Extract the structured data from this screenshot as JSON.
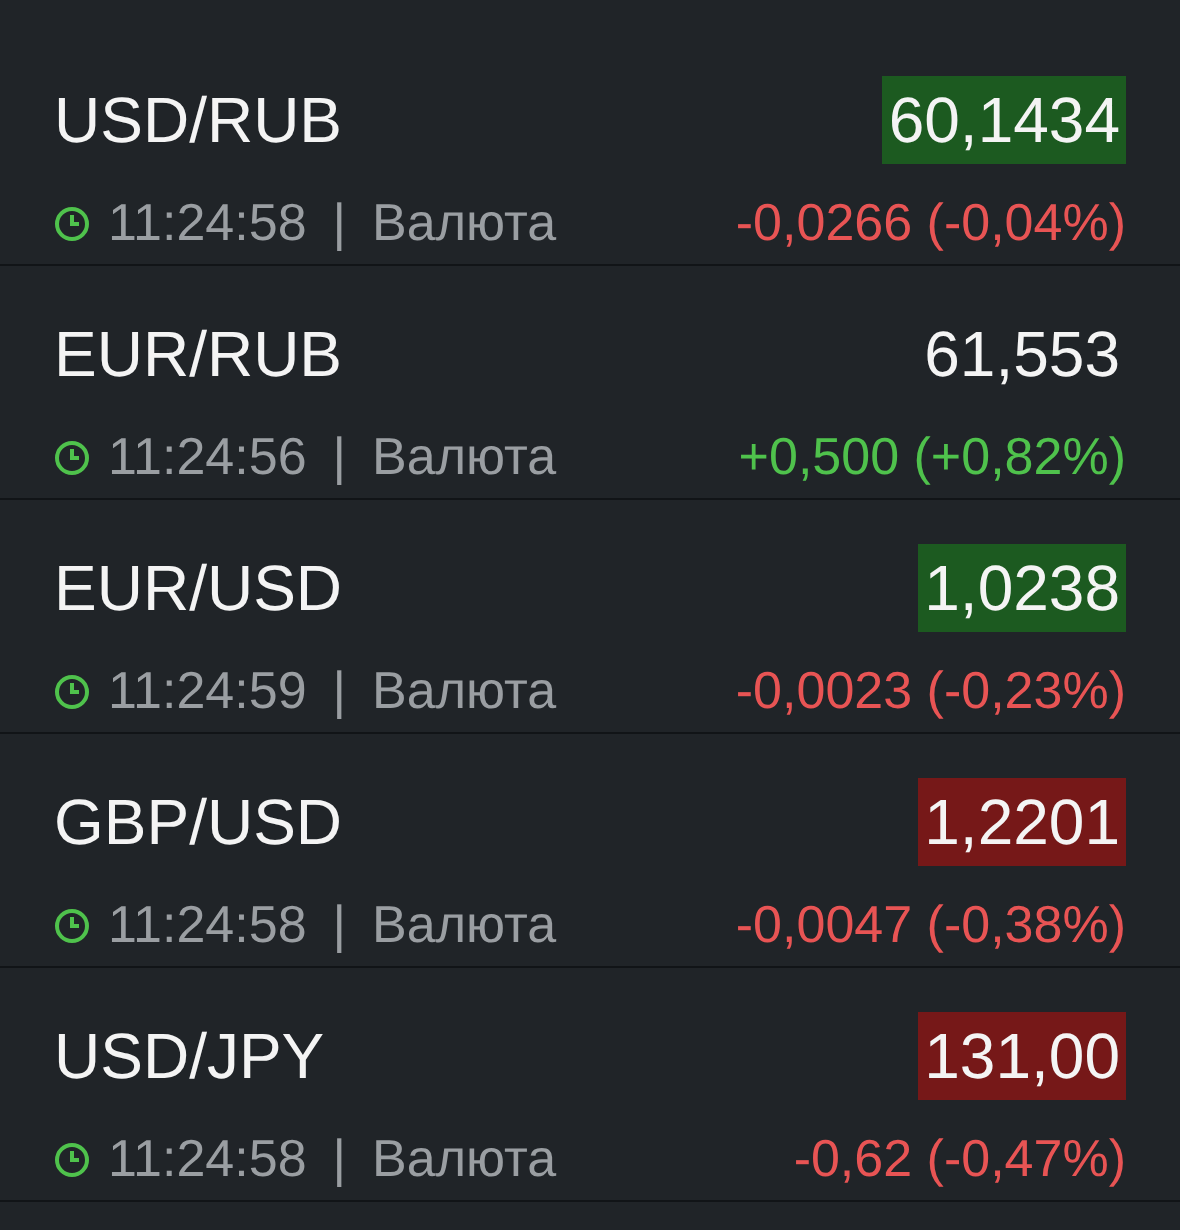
{
  "quotes": [
    {
      "pair": "USD/RUB",
      "price": {
        "text": "60,1434",
        "highlight": {
          "color": "#1c5a20"
        }
      },
      "time": "11:24:58",
      "separator": "|",
      "category": "Валюта",
      "change": {
        "text": "-0,0266 (-0,04%)",
        "color": "#e85454"
      }
    },
    {
      "pair": "EUR/RUB",
      "price": {
        "text": "61,553"
      },
      "time": "11:24:56",
      "separator": "|",
      "category": "Валюта",
      "change": {
        "text": "+0,500 (+0,82%)",
        "color": "#4fc24c"
      }
    },
    {
      "pair": "EUR/USD",
      "price": {
        "text": "1,0238",
        "highlight": {
          "color": "#1c5a20"
        }
      },
      "time": "11:24:59",
      "separator": "|",
      "category": "Валюта",
      "change": {
        "text": "-0,0023 (-0,23%)",
        "color": "#e85454"
      }
    },
    {
      "pair": "GBP/USD",
      "price": {
        "text": "1,2201",
        "highlight": {
          "color": "#761818"
        }
      },
      "time": "11:24:58",
      "separator": "|",
      "category": "Валюта",
      "change": {
        "text": "-0,0047 (-0,38%)",
        "color": "#e85454"
      }
    },
    {
      "pair": "USD/JPY",
      "price": {
        "text": "131,00",
        "highlight": {
          "color": "#761818"
        }
      },
      "time": "11:24:58",
      "separator": "|",
      "category": "Валюта",
      "change": {
        "text": "-0,62 (-0,47%)",
        "color": "#e85454"
      }
    }
  ]
}
